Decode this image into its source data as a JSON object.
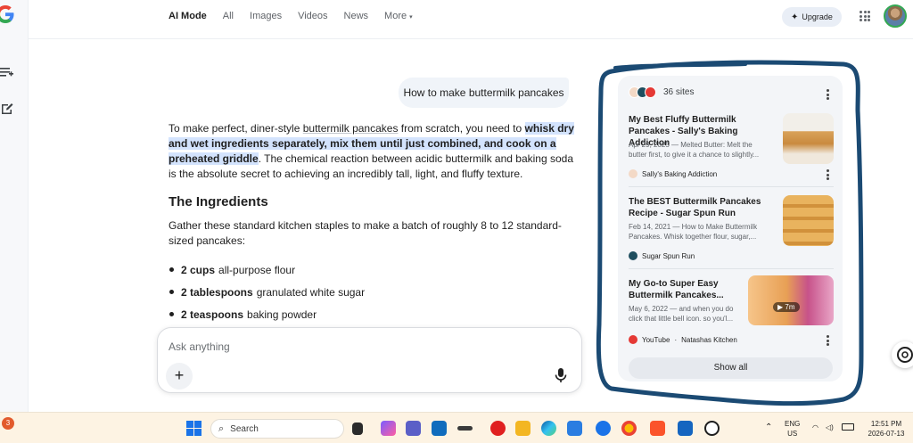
{
  "nav": {
    "tabs": [
      "AI Mode",
      "All",
      "Images",
      "Videos",
      "News",
      "More"
    ],
    "upgrade_label": "Upgrade"
  },
  "chat": {
    "query": "How to make buttermilk pancakes",
    "intro_part1": "To make perfect, diner-style ",
    "intro_link": "buttermilk pancakes",
    "intro_part2": " from scratch, you need to ",
    "intro_highlight": "whisk dry and wet ingredients separately, mix them until just combined, and cook on a preheated griddle",
    "intro_part3": ". The chemical reaction between acidic buttermilk and baking soda is the absolute secret to achieving an incredibly tall, light, and fluffy texture.",
    "section_title": "The Ingredients",
    "section_intro": "Gather these standard kitchen staples to make a batch of roughly 8 to 12 standard-sized pancakes:",
    "ingredients": [
      {
        "qty": "2 cups",
        "item": "all-purpose flour"
      },
      {
        "qty": "2 tablespoons",
        "item": "granulated white sugar"
      },
      {
        "qty": "2 teaspoons",
        "item": "baking powder"
      }
    ]
  },
  "input": {
    "placeholder": "Ask anything"
  },
  "sources": {
    "count_label": "36 sites",
    "items": [
      {
        "title": "My Best Fluffy Buttermilk Pancakes - Sally's Baking Addiction",
        "snippet": "Apr 29, 2025 — Melted Butter: Melt the butter first, to give it a chance to slightly...",
        "site": "Sally's Baking Addiction"
      },
      {
        "title": "The BEST Buttermilk Pancakes Recipe - Sugar Spun Run",
        "snippet": "Feb 14, 2021 — How to Make Buttermilk Pancakes. Whisk together flour, sugar,...",
        "site": "Sugar Spun Run"
      },
      {
        "title": "My Go-to Super Easy Buttermilk Pancakes...",
        "snippet": "May 6, 2022 — and when you do click that little bell icon. so you'l...",
        "site": "YouTube",
        "site_sub": "Natashas Kitchen",
        "duration": "7m"
      }
    ],
    "show_all": "Show all"
  },
  "taskbar": {
    "notification_count": "3",
    "search_label": "Search",
    "lang_top": "ENG",
    "lang_bottom": "US",
    "time": "12:51 PM",
    "date": "2026-07-13"
  },
  "colors": {
    "highlight": "#d3e3fd",
    "panel_bg": "#f3f5f8",
    "scribble": "#1b4a73",
    "taskbar_bg": "#fdf3e3"
  }
}
